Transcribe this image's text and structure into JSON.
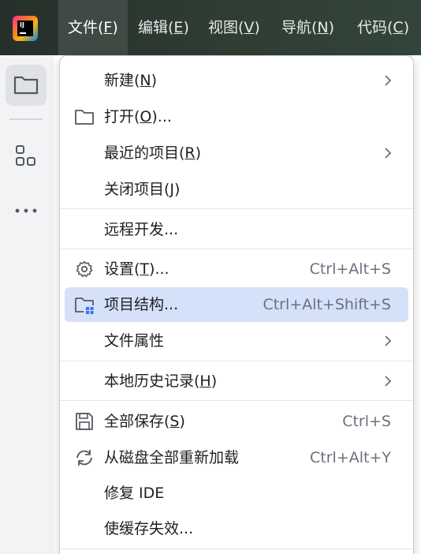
{
  "menubar": [
    {
      "pre": "文件(",
      "mn": "F",
      "post": ")"
    },
    {
      "pre": "编辑(",
      "mn": "E",
      "post": ")"
    },
    {
      "pre": "视图(",
      "mn": "V",
      "post": ")"
    },
    {
      "pre": "导航(",
      "mn": "N",
      "post": ")"
    },
    {
      "pre": "代码(",
      "mn": "C",
      "post": ")"
    }
  ],
  "logo_text": "IJ",
  "file_menu": [
    {
      "pre": "新建(",
      "mn": "N",
      "post": ")",
      "shortcut": "",
      "submenu": true,
      "icon": ""
    },
    {
      "pre": "打开(",
      "mn": "O",
      "post": ")...",
      "shortcut": "",
      "submenu": false,
      "icon": "folder-icon"
    },
    {
      "pre": "最近的项目(",
      "mn": "R",
      "post": ")",
      "shortcut": "",
      "submenu": true,
      "icon": ""
    },
    {
      "pre": "关闭项目(",
      "mn": "J",
      "post": ")",
      "shortcut": "",
      "submenu": false,
      "icon": ""
    },
    {
      "pre": "远程开发...",
      "mn": "",
      "post": "",
      "shortcut": "",
      "submenu": false,
      "icon": ""
    },
    {
      "pre": "设置(",
      "mn": "T",
      "post": ")...",
      "shortcut": "Ctrl+Alt+S",
      "submenu": false,
      "icon": "gear-icon"
    },
    {
      "pre": "项目结构...",
      "mn": "",
      "post": "",
      "shortcut": "Ctrl+Alt+Shift+S",
      "submenu": false,
      "icon": "project-structure-icon"
    },
    {
      "pre": "文件属性",
      "mn": "",
      "post": "",
      "shortcut": "",
      "submenu": true,
      "icon": ""
    },
    {
      "pre": "本地历史记录(",
      "mn": "H",
      "post": ")",
      "shortcut": "",
      "submenu": true,
      "icon": ""
    },
    {
      "pre": "全部保存(",
      "mn": "S",
      "post": ")",
      "shortcut": "Ctrl+S",
      "submenu": false,
      "icon": "save-icon"
    },
    {
      "pre": "从磁盘全部重新加载",
      "mn": "",
      "post": "",
      "shortcut": "Ctrl+Alt+Y",
      "submenu": false,
      "icon": "reload-icon"
    },
    {
      "pre": "修复 IDE",
      "mn": "",
      "post": "",
      "shortcut": "",
      "submenu": false,
      "icon": ""
    },
    {
      "pre": "使缓存失效...",
      "mn": "",
      "post": "",
      "shortcut": "",
      "submenu": false,
      "icon": ""
    }
  ],
  "colors": {
    "accent_hover": "#d5e1f9",
    "menubar_bg": "#2f3d33",
    "shortcut_text": "#6c707e"
  }
}
